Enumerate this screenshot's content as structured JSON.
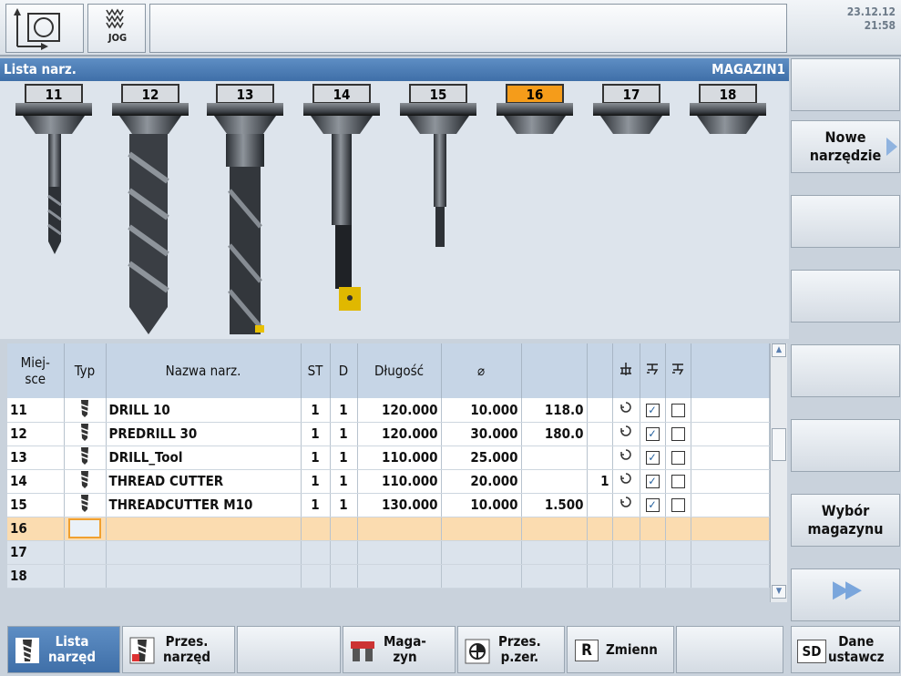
{
  "header": {
    "mode": "JOG",
    "date": "23.12.12",
    "time": "21:58"
  },
  "title": {
    "left": "Lista narz.",
    "right": "MAGAZIN1"
  },
  "slots": [
    "11",
    "12",
    "13",
    "14",
    "15",
    "16",
    "17",
    "18"
  ],
  "active_slot": "16",
  "table": {
    "headers": {
      "place": "Miej-\nsce",
      "type": "Typ",
      "name": "Nazwa narz.",
      "st": "ST",
      "d": "D",
      "length": "Długość",
      "diameter": "⌀"
    },
    "rows": [
      {
        "place": "11",
        "name": "DRILL 10",
        "st": "1",
        "d": "1",
        "length": "120.000",
        "diameter": "10.000",
        "angle": "118.0",
        "extra": ""
      },
      {
        "place": "12",
        "name": "PREDRILL 30",
        "st": "1",
        "d": "1",
        "length": "120.000",
        "diameter": "30.000",
        "angle": "180.0",
        "extra": ""
      },
      {
        "place": "13",
        "name": "DRILL_Tool",
        "st": "1",
        "d": "1",
        "length": "110.000",
        "diameter": "25.000",
        "angle": "",
        "extra": ""
      },
      {
        "place": "14",
        "name": "THREAD CUTTER",
        "st": "1",
        "d": "1",
        "length": "110.000",
        "diameter": "20.000",
        "angle": "",
        "extra": "1"
      },
      {
        "place": "15",
        "name": "THREADCUTTER M10",
        "st": "1",
        "d": "1",
        "length": "130.000",
        "diameter": "10.000",
        "angle": "1.500",
        "extra": ""
      }
    ],
    "empty_places": [
      "16",
      "17",
      "18"
    ]
  },
  "vertical_softkeys": [
    {
      "label": "",
      "arrow": false
    },
    {
      "label": "Nowe narzędzie",
      "arrow": true
    },
    {
      "label": "",
      "arrow": false
    },
    {
      "label": "",
      "arrow": false
    },
    {
      "label": "",
      "arrow": false
    },
    {
      "label": "",
      "arrow": false
    },
    {
      "label": "Wybór magazynu",
      "arrow": false
    },
    {
      "label": "▶▶",
      "arrow": false
    }
  ],
  "horizontal_softkeys": {
    "tool_list": "Lista\nnarzęd",
    "tool_wear": "Przes.\nnarzęd",
    "magazine": "Maga-\nzyn",
    "work_offset": "Przes.\np.zer.",
    "variables": "Zmienn",
    "setting_data": "Dane\nustawcz"
  },
  "colors": {
    "accent": "#4a7ab5",
    "active_slot": "#f59c1a",
    "selected_row": "#fbdcb0"
  }
}
